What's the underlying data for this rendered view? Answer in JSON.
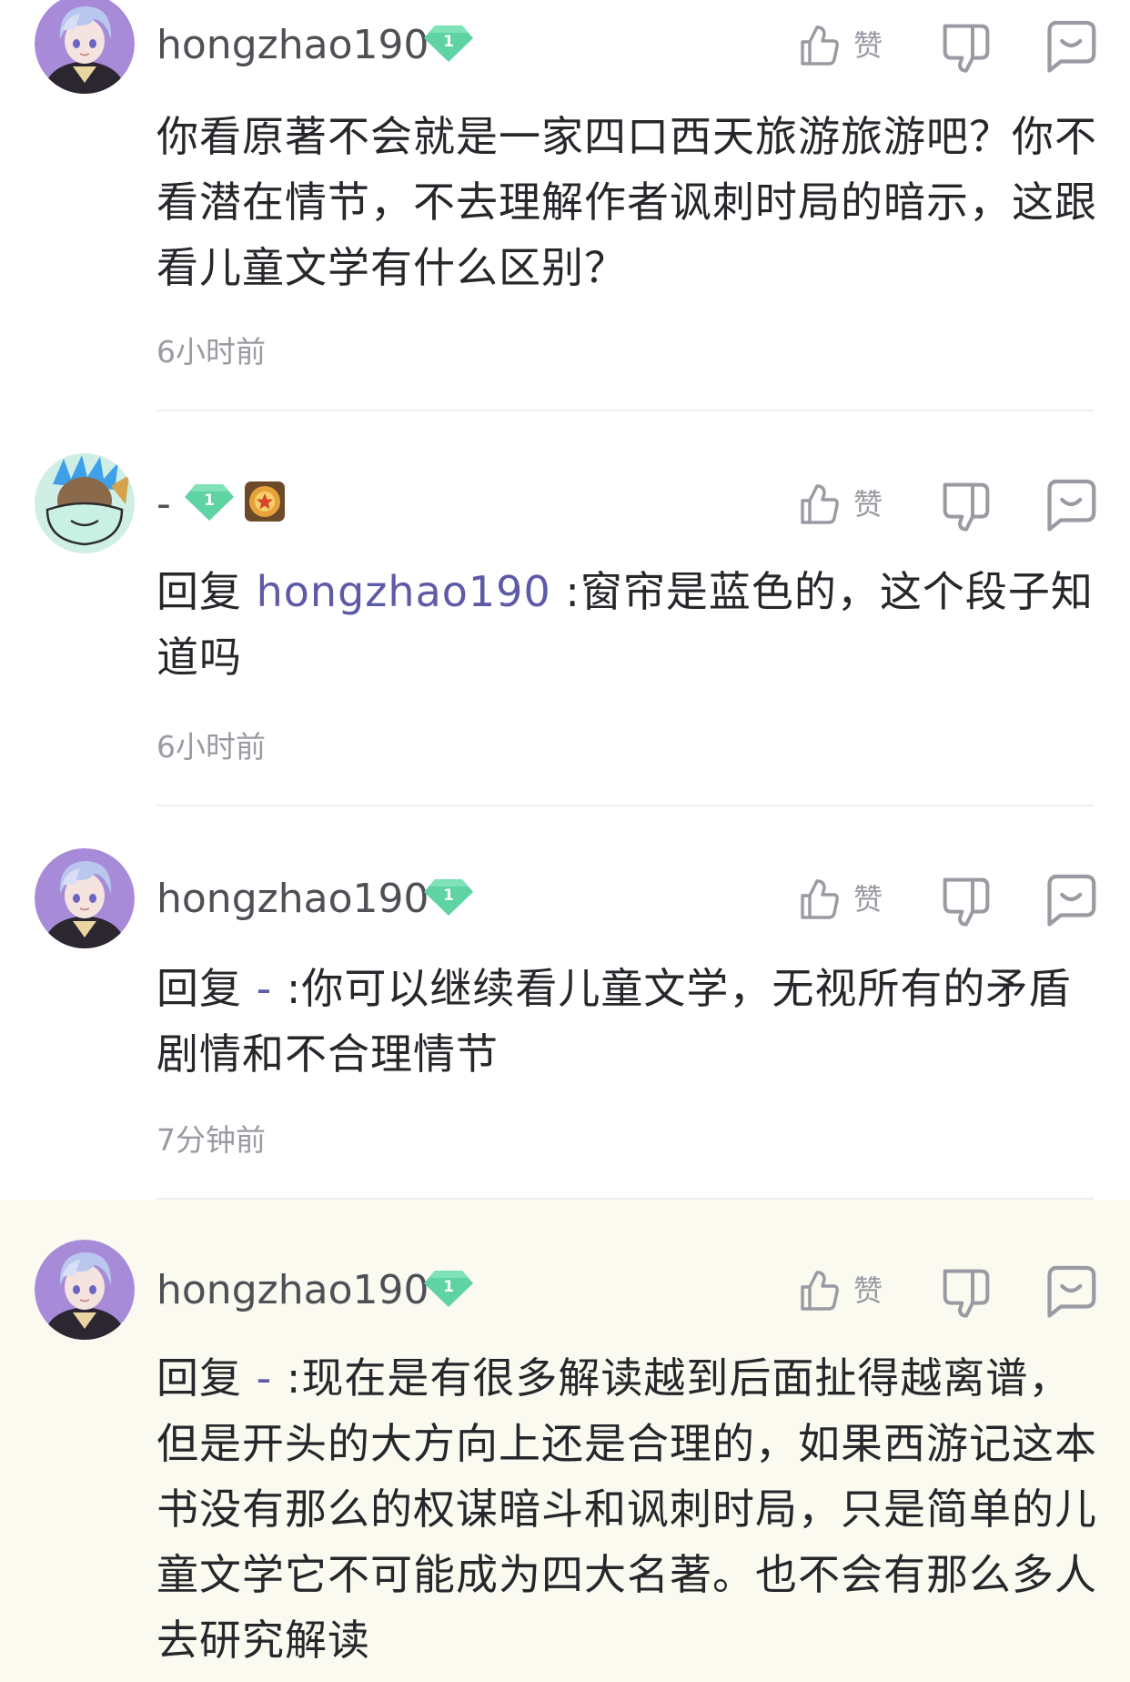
{
  "comments": [
    {
      "username": "hongzhao190",
      "level": "1",
      "reply_prefix": "",
      "mention": "",
      "separator": "",
      "text": "你看原著不会就是一家四口西天旅游旅游吧？你不看潜在情节，不去理解作者讽刺时局的暗示，这跟看儿童文学有什么区别？",
      "like_label": "赞",
      "time": "6小时前"
    },
    {
      "username": "-",
      "level": "1",
      "reply_prefix": "回复",
      "mention": "hongzhao190",
      "separator": ":",
      "text": "窗帘是蓝色的，这个段子知道吗",
      "like_label": "赞",
      "time": "6小时前"
    },
    {
      "username": "hongzhao190",
      "level": "1",
      "reply_prefix": "回复",
      "mention": "-",
      "separator": ":",
      "text": "你可以继续看儿童文学，无视所有的矛盾剧情和不合理情节",
      "like_label": "赞",
      "time": "7分钟前"
    },
    {
      "username": "hongzhao190",
      "level": "1",
      "reply_prefix": "回复",
      "mention": "-",
      "separator": ":",
      "text": "现在是有很多解读越到后面扯得越离谱，但是开头的大方向上还是合理的，如果西游记这本书没有那么的权谋暗斗和讽刺时局，只是简单的儿童文学它不可能成为四大名著。也不会有那么多人去研究解读",
      "like_label": "赞",
      "time": ""
    }
  ],
  "colors": {
    "username": "#4f4f55",
    "mention": "#5d5aa8",
    "level_badge": "#5fd3a3",
    "icon": "#9a9aa2",
    "highlight_bg": "#fbfaf1"
  }
}
